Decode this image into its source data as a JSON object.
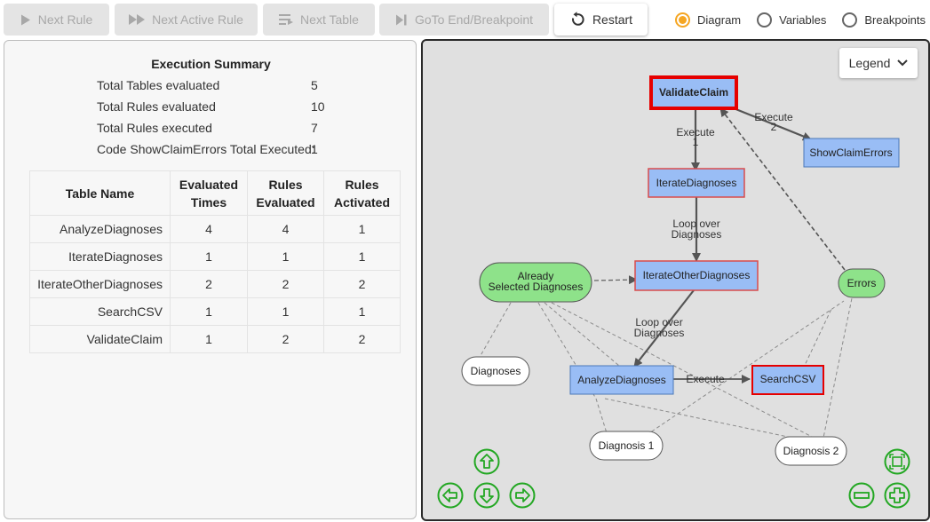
{
  "toolbar": {
    "next_rule": "Next Rule",
    "next_active_rule": "Next Active Rule",
    "next_table": "Next Table",
    "goto_end": "GoTo End/Breakpoint",
    "restart": "Restart"
  },
  "view_options": {
    "diagram": "Diagram",
    "variables": "Variables",
    "breakpoints": "Breakpoints",
    "selected": "Diagram"
  },
  "summary": {
    "title": "Execution Summary",
    "rows": [
      {
        "label": "Total Tables evaluated",
        "value": "5"
      },
      {
        "label": "Total Rules evaluated",
        "value": "10"
      },
      {
        "label": "Total Rules executed",
        "value": "7"
      },
      {
        "label": "Code ShowClaimErrors Total Executed:",
        "value": "1"
      }
    ]
  },
  "rules_table": {
    "headers": {
      "name": "Table Name",
      "evaluated_1": "Evaluated",
      "evaluated_2": "Times",
      "rules_eval_1": "Rules",
      "rules_eval_2": "Evaluated",
      "rules_act_1": "Rules",
      "rules_act_2": "Activated"
    },
    "rows": [
      {
        "name": "AnalyzeDiagnoses",
        "evaluated": "4",
        "rules_evaluated": "4",
        "rules_activated": "1"
      },
      {
        "name": "IterateDiagnoses",
        "evaluated": "1",
        "rules_evaluated": "1",
        "rules_activated": "1"
      },
      {
        "name": "IterateOtherDiagnoses",
        "evaluated": "2",
        "rules_evaluated": "2",
        "rules_activated": "2"
      },
      {
        "name": "SearchCSV",
        "evaluated": "1",
        "rules_evaluated": "1",
        "rules_activated": "1"
      },
      {
        "name": "ValidateClaim",
        "evaluated": "1",
        "rules_evaluated": "2",
        "rules_activated": "2"
      }
    ]
  },
  "diagram": {
    "legend_label": "Legend",
    "nodes": {
      "validate_claim": "ValidateClaim",
      "show_claim_errors": "ShowClaimErrors",
      "iterate_diagnoses": "IterateDiagnoses",
      "iterate_other_diagnoses": "IterateOtherDiagnoses",
      "already_1": "Already",
      "already_2": "Selected Diagnoses",
      "errors": "Errors",
      "diagnoses": "Diagnoses",
      "analyze_diagnoses": "AnalyzeDiagnoses",
      "search_csv": "SearchCSV",
      "diagnosis_1": "Diagnosis 1",
      "diagnosis_2": "Diagnosis 2"
    },
    "edges": {
      "execute_1a": "Execute",
      "execute_1b": "1",
      "execute_2a": "Execute",
      "execute_2b": "2",
      "loop_1a": "Loop over",
      "loop_1b": "Diagnoses",
      "loop_2a": "Loop over",
      "loop_2b": "Diagnoses",
      "execute": "Execute"
    },
    "colors": {
      "table_node": "#99bdf5",
      "variable_node": "#8ee28a",
      "active_border": "#e60000",
      "executed_border": "#d94c4c",
      "control_green": "#22a722"
    }
  }
}
